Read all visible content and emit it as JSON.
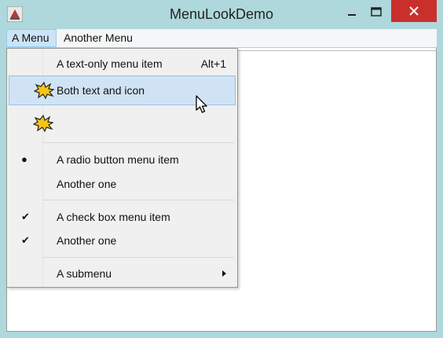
{
  "window": {
    "title": "MenuLookDemo",
    "colors": {
      "title_bg": "#aed8db",
      "close_bg": "#c9302c",
      "highlight": "#d0e3f4"
    }
  },
  "menubar": {
    "items": [
      {
        "label": "A Menu",
        "state": "open"
      },
      {
        "label": "Another Menu"
      }
    ]
  },
  "popup_menu": {
    "items": [
      {
        "type": "item",
        "label": "A text-only menu item",
        "accelerator": "Alt+1"
      },
      {
        "type": "item",
        "label": "Both text and icon",
        "icon": "star-burst-icon",
        "highlighted": true
      },
      {
        "type": "item",
        "label": "",
        "icon": "star-burst-icon"
      },
      {
        "type": "separator"
      },
      {
        "type": "radio",
        "label": "A radio button menu item",
        "checked": true
      },
      {
        "type": "radio",
        "label": "Another one",
        "checked": false
      },
      {
        "type": "separator"
      },
      {
        "type": "checkbox",
        "label": "A check box menu item",
        "checked": true
      },
      {
        "type": "checkbox",
        "label": "Another one",
        "checked": true
      },
      {
        "type": "separator"
      },
      {
        "type": "submenu",
        "label": "A submenu"
      }
    ],
    "marks": {
      "radio": "●",
      "check": "✔"
    }
  }
}
